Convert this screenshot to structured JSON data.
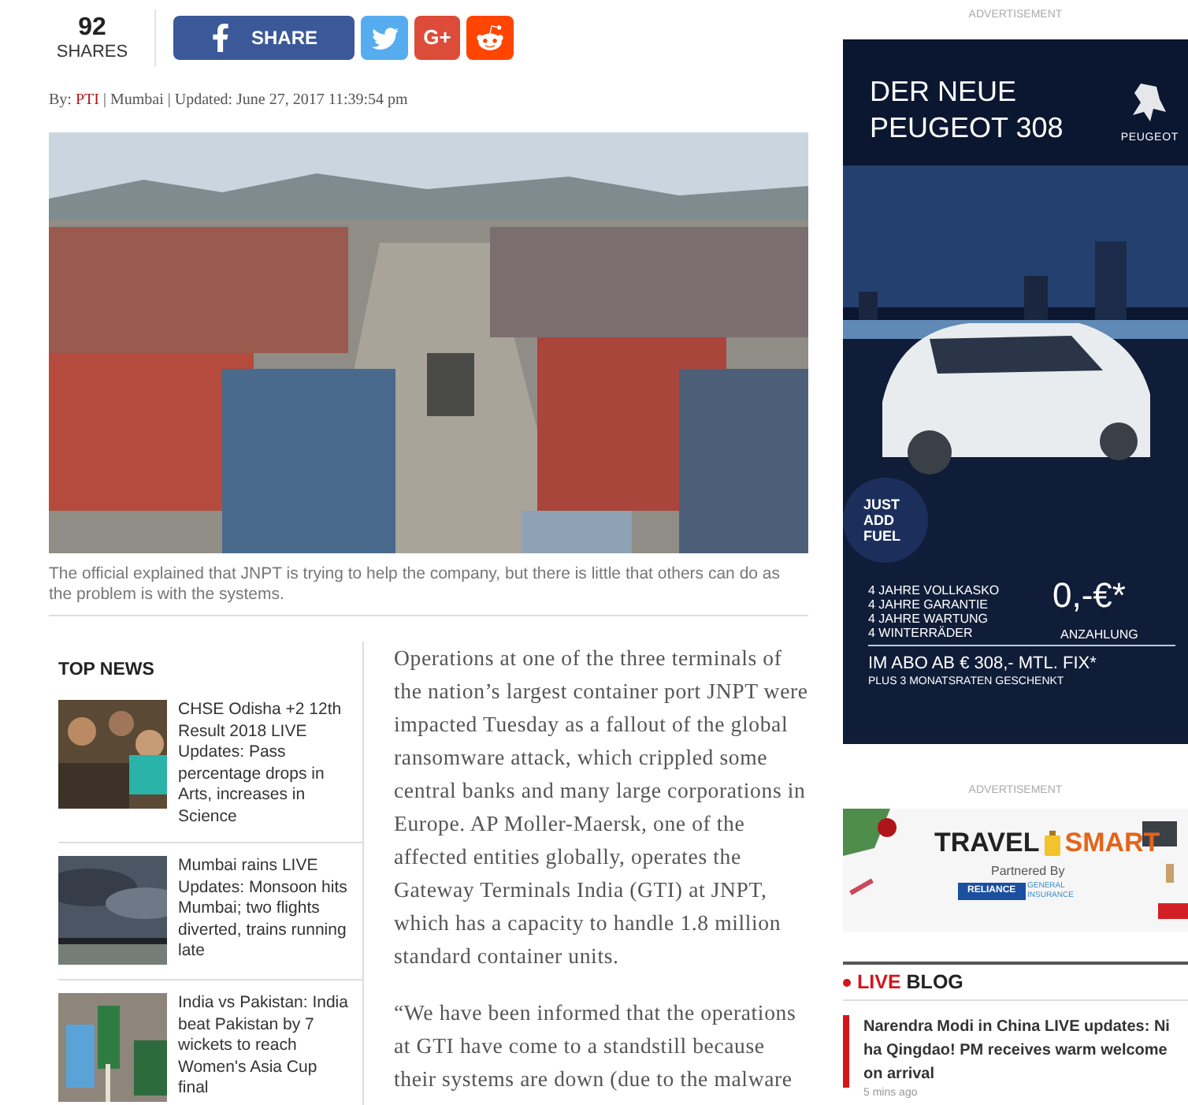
{
  "share_bar": {
    "count": "92",
    "count_label": "SHARES",
    "buttons": [
      {
        "kind": "facebook",
        "label": "SHARE"
      },
      {
        "kind": "twitter"
      },
      {
        "kind": "googleplus",
        "label": "G+"
      },
      {
        "kind": "reddit"
      }
    ]
  },
  "byline": {
    "prefix": "By:",
    "author": "PTI",
    "separator": "|",
    "location": "Mumbai",
    "separator_2": "|",
    "updated": "Updated: June 27, 2017 11:39:54 pm"
  },
  "photo": {
    "caption": "The official explained that JNPT is trying to help the company, but there is little that others can do as the problem is with the systems."
  },
  "top_news": {
    "title": "TOP NEWS",
    "items": [
      {
        "headline": "CHSE Odisha +2 12th Result 2018 LIVE Updates: Pass percentage drops in Arts, increases in Science"
      },
      {
        "headline": "Mumbai rains LIVE Updates: Monsoon hits Mumbai; two flights diverted, trains running late"
      },
      {
        "headline": "India vs Pakistan: India beat Pakistan by 7 wickets to reach Women's Asia Cup final"
      }
    ]
  },
  "article": {
    "paragraphs": [
      "Operations at one of the three terminals of the nation’s largest container port JNPT were impacted Tuesday as a fallout of the global ransomware attack, which crippled some central banks and many large corporations in Europe. AP Moller-Maersk, one of the affected entities globally, operates the Gateway Terminals India (GTI) at JNPT, which has a capacity to handle 1.8 million standard container units.",
      "“We have been informed that the operations at GTI have come to a standstill because their systems are down (due to the malware"
    ]
  },
  "car_ad": {
    "label": "ADVERTISEMENT",
    "headline": [
      "DER NEUE",
      "PEUGEOT 308"
    ],
    "brand": "PEUGEOT",
    "badge": [
      "JUST",
      "ADD",
      "FUEL"
    ],
    "features": [
      "4 JAHRE VOLLKASKO",
      "4 JAHRE GARANTIE",
      "4 JAHRE WARTUNG",
      "4 WINTERRÄDER"
    ],
    "price": "0,-€*",
    "price_label": "ANZAHLUNG",
    "offer": "IM ABO AB € 308,- MTL. FIX*",
    "bonus": "PLUS 3 MONATSRATEN GESCHENKT"
  },
  "travel_ad": {
    "label": "ADVERTISEMENT",
    "title_left": "TRAVEL",
    "title_right": "SMART",
    "partner_label": "Partnered By",
    "partner": "RELIANCE",
    "partner_sub": "GENERAL INSURANCE"
  },
  "live_blog": {
    "live": "LIVE",
    "title": "BLOG",
    "items": [
      {
        "headline": "Narendra Modi in China LIVE updates: Ni ha Qingdao! PM receives warm welcome on arrival",
        "time": "5 mins ago"
      }
    ]
  }
}
